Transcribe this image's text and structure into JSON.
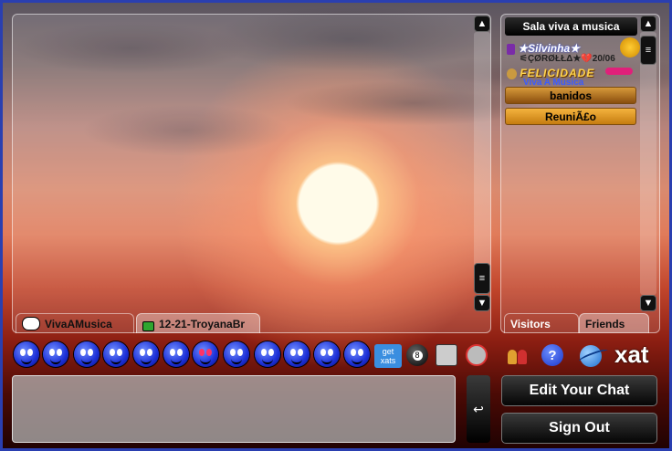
{
  "chat": {
    "tabs": [
      {
        "label": "VivaAMusica",
        "icon": "speech-bubble-icon"
      },
      {
        "label": "12-21-TroyanaBr",
        "icon": "padlock-icon"
      }
    ]
  },
  "users": {
    "title": "Sala viva a musica",
    "list": [
      {
        "name": "★Silvinha★",
        "color": "#ffffff"
      },
      {
        "name": "⚟ÇØRØŁŁΔ★💔20/06",
        "color": "#222222"
      },
      {
        "name": "FELICIDADE",
        "color": "#ffd34d"
      },
      {
        "name": "Viva A Musica",
        "color": "#3a5bff"
      }
    ],
    "groups": [
      {
        "label": "banidos"
      },
      {
        "label": "ReuniÃ£o"
      }
    ],
    "tabs": {
      "visitors": "Visitors",
      "friends": "Friends"
    }
  },
  "toolbar": {
    "get_xats": "get\nxats",
    "icons": [
      "smiley-icon",
      "8-ball-icon",
      "cash-register-icon",
      "no-sound-icon",
      "users-icon",
      "help-icon",
      "xat-logo-icon"
    ],
    "logo_text": "xat"
  },
  "input": {
    "send_symbol": "↩"
  },
  "buttons": {
    "edit": "Edit Your Chat",
    "signout": "Sign Out"
  }
}
